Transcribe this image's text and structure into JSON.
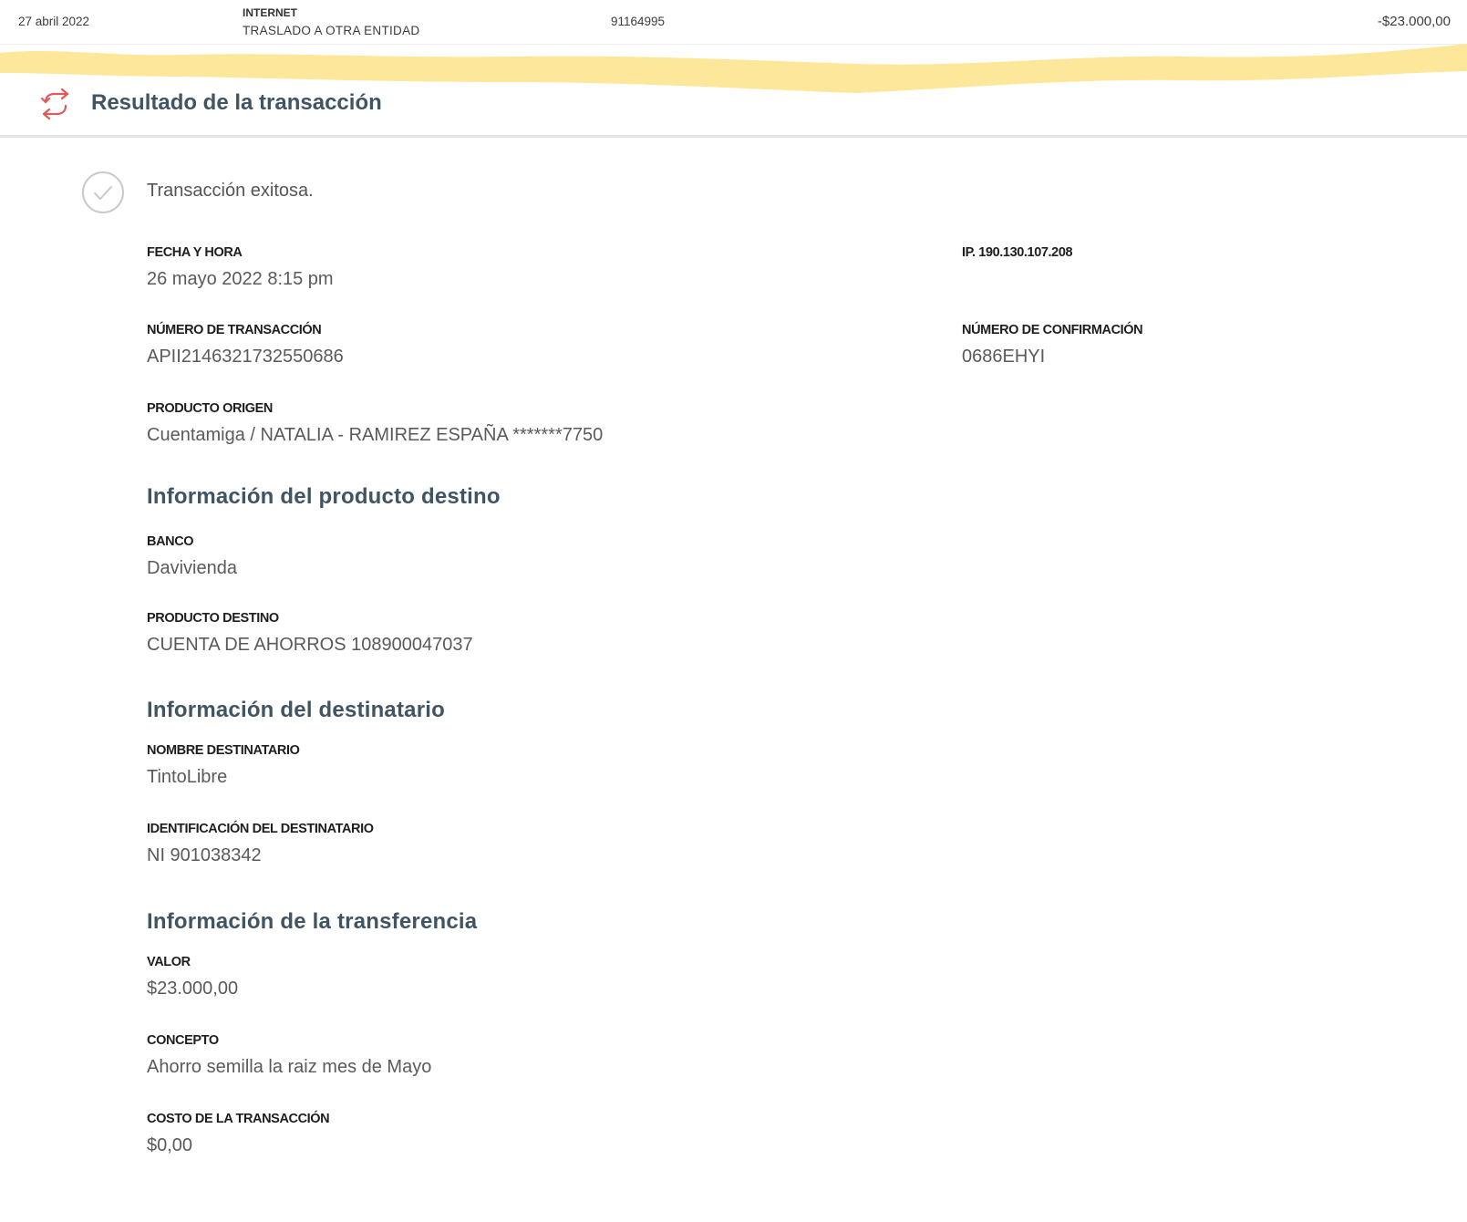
{
  "top_row": {
    "date": "27 abril 2022",
    "channel": "INTERNET",
    "description": "TRASLADO A OTRA ENTIDAD",
    "reference": "91164995",
    "amount": "-$23.000,00"
  },
  "header": {
    "title": "Resultado de la transacción",
    "icon": "transfer-arrows-icon",
    "icon_color": "#e05a5a",
    "title_color": "#415464"
  },
  "status": {
    "icon": "check-circle-icon",
    "text": "Transacción exitosa."
  },
  "fields": {
    "fecha_hora": {
      "label": "FECHA Y HORA",
      "value": "26 mayo 2022 8:15 pm"
    },
    "ip": {
      "label": "IP. 190.130.107.208"
    },
    "numero_transaccion": {
      "label": "NÚMERO DE TRANSACCIÓN",
      "value": "APII2146321732550686"
    },
    "numero_confirmacion": {
      "label": "NÚMERO DE CONFIRMACIÓN",
      "value": "0686EHYI"
    },
    "producto_origen": {
      "label": "PRODUCTO ORIGEN",
      "value": "Cuentamiga / NATALIA - RAMIREZ ESPAÑA *******7750"
    }
  },
  "sections": {
    "destino": {
      "title": "Información del producto destino",
      "banco": {
        "label": "BANCO",
        "value": "Davivienda"
      },
      "producto_destino": {
        "label": "PRODUCTO DESTINO",
        "value": "CUENTA DE AHORROS 108900047037"
      }
    },
    "destinatario": {
      "title": "Información del destinatario",
      "nombre": {
        "label": "NOMBRE DESTINATARIO",
        "value": "TintoLibre"
      },
      "identificacion": {
        "label": "IDENTIFICACIÓN DEL DESTINATARIO",
        "value": "NI 901038342"
      }
    },
    "transferencia": {
      "title": "Información de la transferencia",
      "valor": {
        "label": "VALOR",
        "value": "$23.000,00"
      },
      "concepto": {
        "label": "CONCEPTO",
        "value": "Ahorro semilla la raiz mes de Mayo"
      },
      "costo": {
        "label": "COSTO DE LA TRANSACCIÓN",
        "value": "$0,00"
      }
    }
  },
  "colors": {
    "highlight": "#fde79a",
    "divider": "#e3e3e3"
  }
}
